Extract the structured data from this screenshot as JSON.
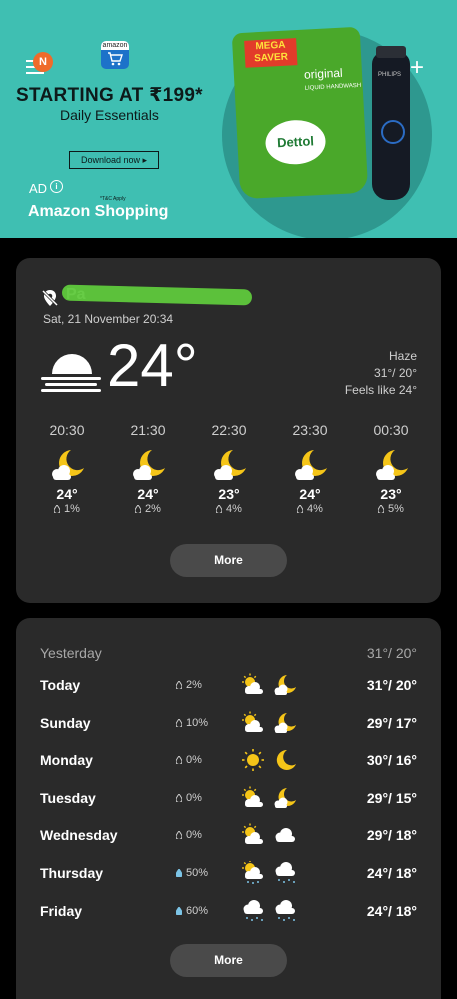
{
  "ad": {
    "badge": "N",
    "logo_text": "amazon",
    "headline": "STARTING AT ₹199*",
    "subline": "Daily Essentials",
    "cta": "Download now ▸",
    "ad_label": "AD",
    "info": "i",
    "tnc": "*T&C Apply",
    "brand": "Amazon Shopping",
    "pouch_badge": "MEGA SAVER",
    "pouch_variant": "original",
    "pouch_type": "LIQUID HANDWASH",
    "pouch_brand": "Dettol",
    "trimmer_brand": "PHILIPS",
    "plus": "+"
  },
  "current": {
    "location": "Pa",
    "datetime": "Sat, 21 November 20:34",
    "temperature": "24°",
    "condition": "Haze",
    "high_low": "31°/ 20°",
    "feels_like": "Feels like 24°",
    "icon": "haze-icon"
  },
  "hourly": [
    {
      "time": "20:30",
      "temp": "24°",
      "precip": "1%",
      "icon": "moon-cloud-icon"
    },
    {
      "time": "21:30",
      "temp": "24°",
      "precip": "2%",
      "icon": "moon-cloud-icon"
    },
    {
      "time": "22:30",
      "temp": "23°",
      "precip": "4%",
      "icon": "moon-cloud-icon"
    },
    {
      "time": "23:30",
      "temp": "24°",
      "precip": "4%",
      "icon": "moon-cloud-icon"
    },
    {
      "time": "00:30",
      "temp": "23°",
      "precip": "5%",
      "icon": "moon-cloud-icon"
    }
  ],
  "more_label": "More",
  "daily": {
    "yesterday_label": "Yesterday",
    "yesterday_temp": "31°/ 20°",
    "days": [
      {
        "day": "Today",
        "precip": "2%",
        "day_icon": "sun-cloud-icon",
        "night_icon": "moon-cloud-icon",
        "temps": "31°/ 20°",
        "drop_color": "#cfcfcf"
      },
      {
        "day": "Sunday",
        "precip": "10%",
        "day_icon": "sun-cloud-icon",
        "night_icon": "moon-cloud-icon",
        "temps": "29°/ 17°",
        "drop_color": "#cfcfcf"
      },
      {
        "day": "Monday",
        "precip": "0%",
        "day_icon": "sun-icon",
        "night_icon": "moon-icon",
        "temps": "30°/ 16°",
        "drop_color": "#cfcfcf"
      },
      {
        "day": "Tuesday",
        "precip": "0%",
        "day_icon": "sun-cloud-icon",
        "night_icon": "moon-cloud-icon",
        "temps": "29°/ 15°",
        "drop_color": "#cfcfcf"
      },
      {
        "day": "Wednesday",
        "precip": "0%",
        "day_icon": "sun-cloud-icon",
        "night_icon": "cloud-icon",
        "temps": "29°/ 18°",
        "drop_color": "#cfcfcf"
      },
      {
        "day": "Thursday",
        "precip": "50%",
        "day_icon": "sun-rain-icon",
        "night_icon": "rain-icon",
        "temps": "24°/ 18°",
        "drop_color": "#7cc4e6"
      },
      {
        "day": "Friday",
        "precip": "60%",
        "day_icon": "rain-icon",
        "night_icon": "rain-icon",
        "temps": "24°/ 18°",
        "drop_color": "#7cc4e6"
      }
    ]
  },
  "colors": {
    "background": "#000000",
    "card": "#2a2a2a",
    "sun": "#f5c518",
    "moon": "#f5c518",
    "cloud": "#ffffff",
    "ad_bg": "#3fbfb2"
  }
}
